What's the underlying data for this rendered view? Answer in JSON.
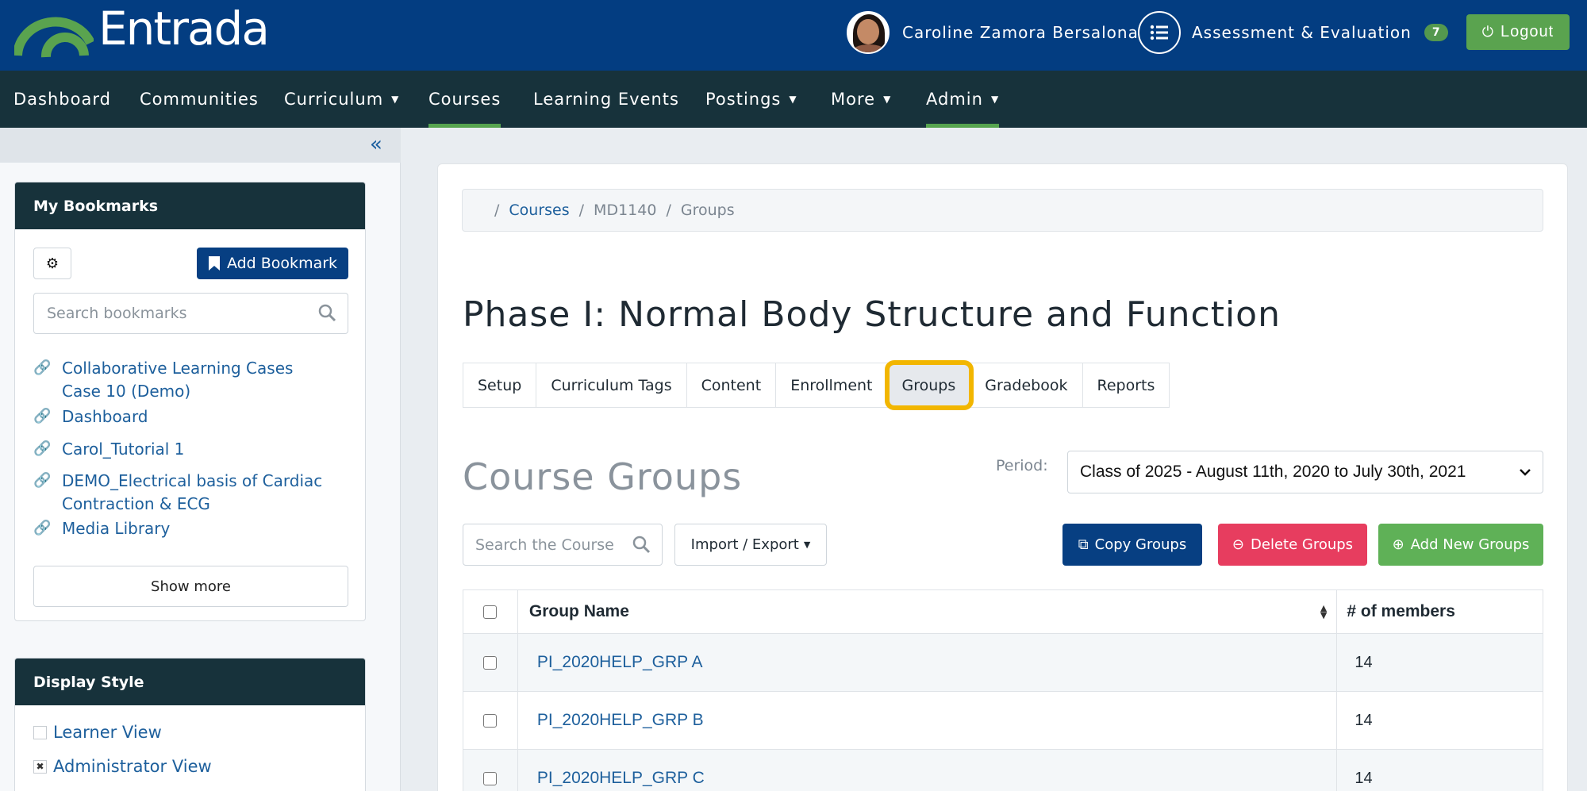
{
  "header": {
    "logo_text": "Entrada",
    "user_name": "Caroline Zamora Bersalona",
    "ae_label": "Assessment & Evaluation",
    "ae_badge": "7",
    "logout_label": "Logout"
  },
  "nav": {
    "items": [
      {
        "label": "Dashboard"
      },
      {
        "label": "Communities"
      },
      {
        "label": "Curriculum"
      },
      {
        "label": "Courses"
      },
      {
        "label": "Learning Events"
      },
      {
        "label": "Postings"
      },
      {
        "label": "More"
      },
      {
        "label": "Admin"
      }
    ]
  },
  "sidebar": {
    "bookmarks_title": "My Bookmarks",
    "add_bookmark_label": "Add Bookmark",
    "search_placeholder": "Search bookmarks",
    "bookmarks": [
      {
        "label": "Collaborative Learning Cases Case 10 (Demo)"
      },
      {
        "label": "Dashboard"
      },
      {
        "label": "Carol_Tutorial 1"
      },
      {
        "label": "DEMO_Electrical basis of Cardiac Contraction & ECG"
      },
      {
        "label": "Media Library"
      }
    ],
    "show_more_label": "Show more",
    "display_style_title": "Display Style",
    "display_styles": [
      {
        "label": "Learner View",
        "checked": false
      },
      {
        "label": "Administrator View",
        "checked": true
      }
    ]
  },
  "breadcrumb": {
    "courses": "Courses",
    "course_code": "MD1140",
    "current": "Groups"
  },
  "page": {
    "title": "Phase I: Normal Body Structure and Function",
    "tabs": [
      {
        "label": "Setup"
      },
      {
        "label": "Curriculum Tags"
      },
      {
        "label": "Content"
      },
      {
        "label": "Enrollment"
      },
      {
        "label": "Groups"
      },
      {
        "label": "Gradebook"
      },
      {
        "label": "Reports"
      }
    ],
    "section_title": "Course Groups",
    "period_label": "Period:",
    "period_value": "Class of 2025 - August 11th, 2020 to July 30th, 2021",
    "course_search_placeholder": "Search the Course",
    "import_export_label": "Import / Export",
    "copy_groups_label": "Copy Groups",
    "delete_groups_label": "Delete Groups",
    "add_groups_label": "Add New Groups"
  },
  "table": {
    "col_name": "Group Name",
    "col_members": "# of members",
    "rows": [
      {
        "name": "PI_2020HELP_GRP A",
        "members": "14"
      },
      {
        "name": "PI_2020HELP_GRP B",
        "members": "14"
      },
      {
        "name": "PI_2020HELP_GRP C",
        "members": "14"
      }
    ]
  },
  "colors": {
    "header_blue": "#033d81",
    "nav_dark": "#17323b",
    "accent_green": "#56a44f",
    "danger_red": "#e73d5f",
    "highlight_yellow": "#f2b600"
  }
}
